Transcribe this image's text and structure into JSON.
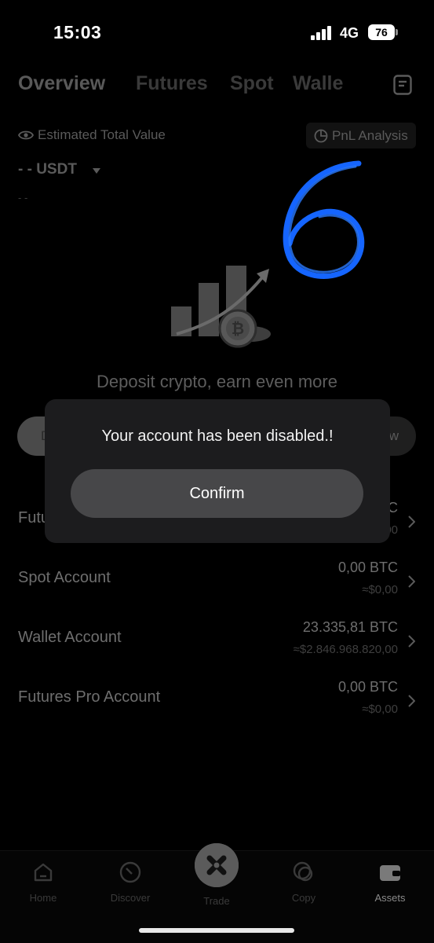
{
  "status_bar": {
    "time": "15:03",
    "network": "4G",
    "battery": "76"
  },
  "tabs": [
    {
      "label": "Overview",
      "active": true
    },
    {
      "label": "Futures"
    },
    {
      "label": "Spot"
    },
    {
      "label": "Walle"
    }
  ],
  "summary": {
    "estimated_label": "Estimated Total Value",
    "pnl_label": "PnL Analysis",
    "balance_value": "- - USDT",
    "balance_sub": "- -"
  },
  "handwritten_annotation": "6",
  "empty_state": {
    "text": "Deposit crypto, earn even more"
  },
  "actions": {
    "left_label": "D",
    "right_label": "w"
  },
  "accounts": [
    {
      "name": "Futu",
      "btc": "TC",
      "fiat": "00"
    },
    {
      "name": "Spot Account",
      "btc": "0,00 BTC",
      "fiat": "≈$0,00"
    },
    {
      "name": "Wallet Account",
      "btc": "23.335,81 BTC",
      "fiat": "≈$2.846.968.820,00"
    },
    {
      "name": "Futures Pro Account",
      "btc": "0,00 BTC",
      "fiat": "≈$0,00"
    }
  ],
  "bottom_nav": [
    {
      "label": "Home",
      "icon": "home-icon"
    },
    {
      "label": "Discover",
      "icon": "compass-icon"
    },
    {
      "label": "Trade",
      "icon": "trade-x-icon"
    },
    {
      "label": "Copy",
      "icon": "copy-icon"
    },
    {
      "label": "Assets",
      "icon": "wallet-icon",
      "active": true
    }
  ],
  "modal": {
    "message": "Your account has been disabled.!",
    "confirm_label": "Confirm"
  },
  "colors": {
    "background": "#000000",
    "modal": "#1c1c1e",
    "confirm_button": "#474749",
    "annotation": "#1565ff"
  }
}
